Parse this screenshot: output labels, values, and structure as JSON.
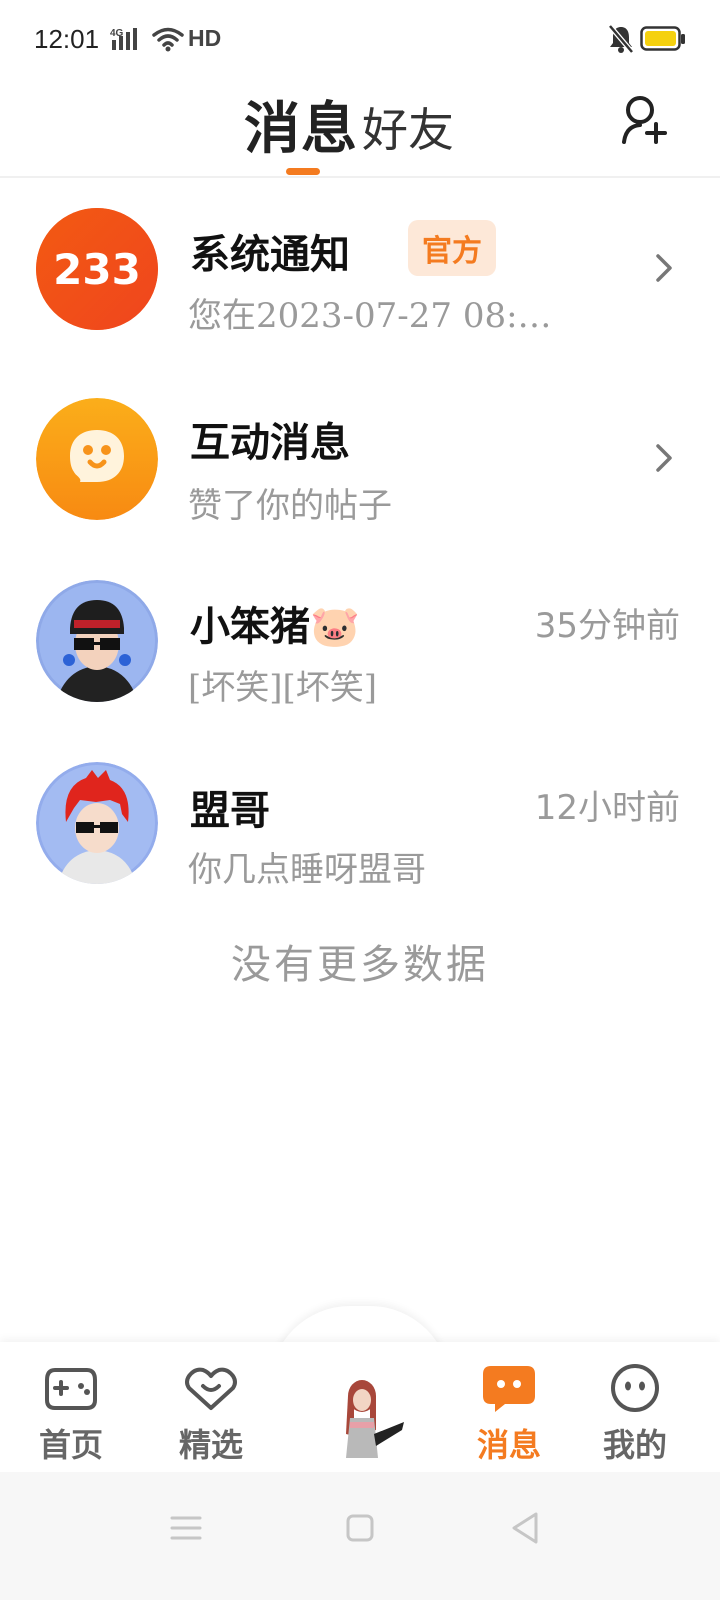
{
  "status_bar": {
    "time": "12:01",
    "network": "4G",
    "hd": "HD",
    "battery_color": "#f5d10f"
  },
  "header": {
    "tab_messages": "消息",
    "tab_friends": "好友",
    "active_tab": "消息",
    "add_friend_icon": "add-person-icon",
    "accent_color": "#f47b20"
  },
  "messages": [
    {
      "title": "系统通知",
      "badge": "官方",
      "preview": "您在2023-07-27 08:…",
      "avatar_text": "233",
      "avatar_color": "#f25516",
      "has_chevron": true
    },
    {
      "title": "互动消息",
      "preview": "赞了你的帖子",
      "avatar_icon": "chat-bubble-smile-icon",
      "avatar_color": "#fb9a16",
      "has_chevron": true
    },
    {
      "title": "小笨猪🐷",
      "preview": "[坏笑][坏笑]",
      "time": "35分钟前",
      "avatar_icon": "character-avatar-icon"
    },
    {
      "title": "盟哥",
      "preview": "你几点睡呀盟哥",
      "time": "12小时前",
      "avatar_icon": "character-avatar-icon"
    }
  ],
  "list_footer": "没有更多数据",
  "bottom_nav": [
    {
      "label": "首页",
      "icon": "gamepad-icon",
      "active": false
    },
    {
      "label": "精选",
      "icon": "heart-chat-icon",
      "active": false
    },
    {
      "label": "",
      "icon": "character-icon",
      "active": false
    },
    {
      "label": "消息",
      "icon": "message-bubble-icon",
      "active": true
    },
    {
      "label": "我的",
      "icon": "face-icon",
      "active": false
    }
  ],
  "system_nav": [
    "menu-icon",
    "home-icon",
    "back-icon"
  ]
}
